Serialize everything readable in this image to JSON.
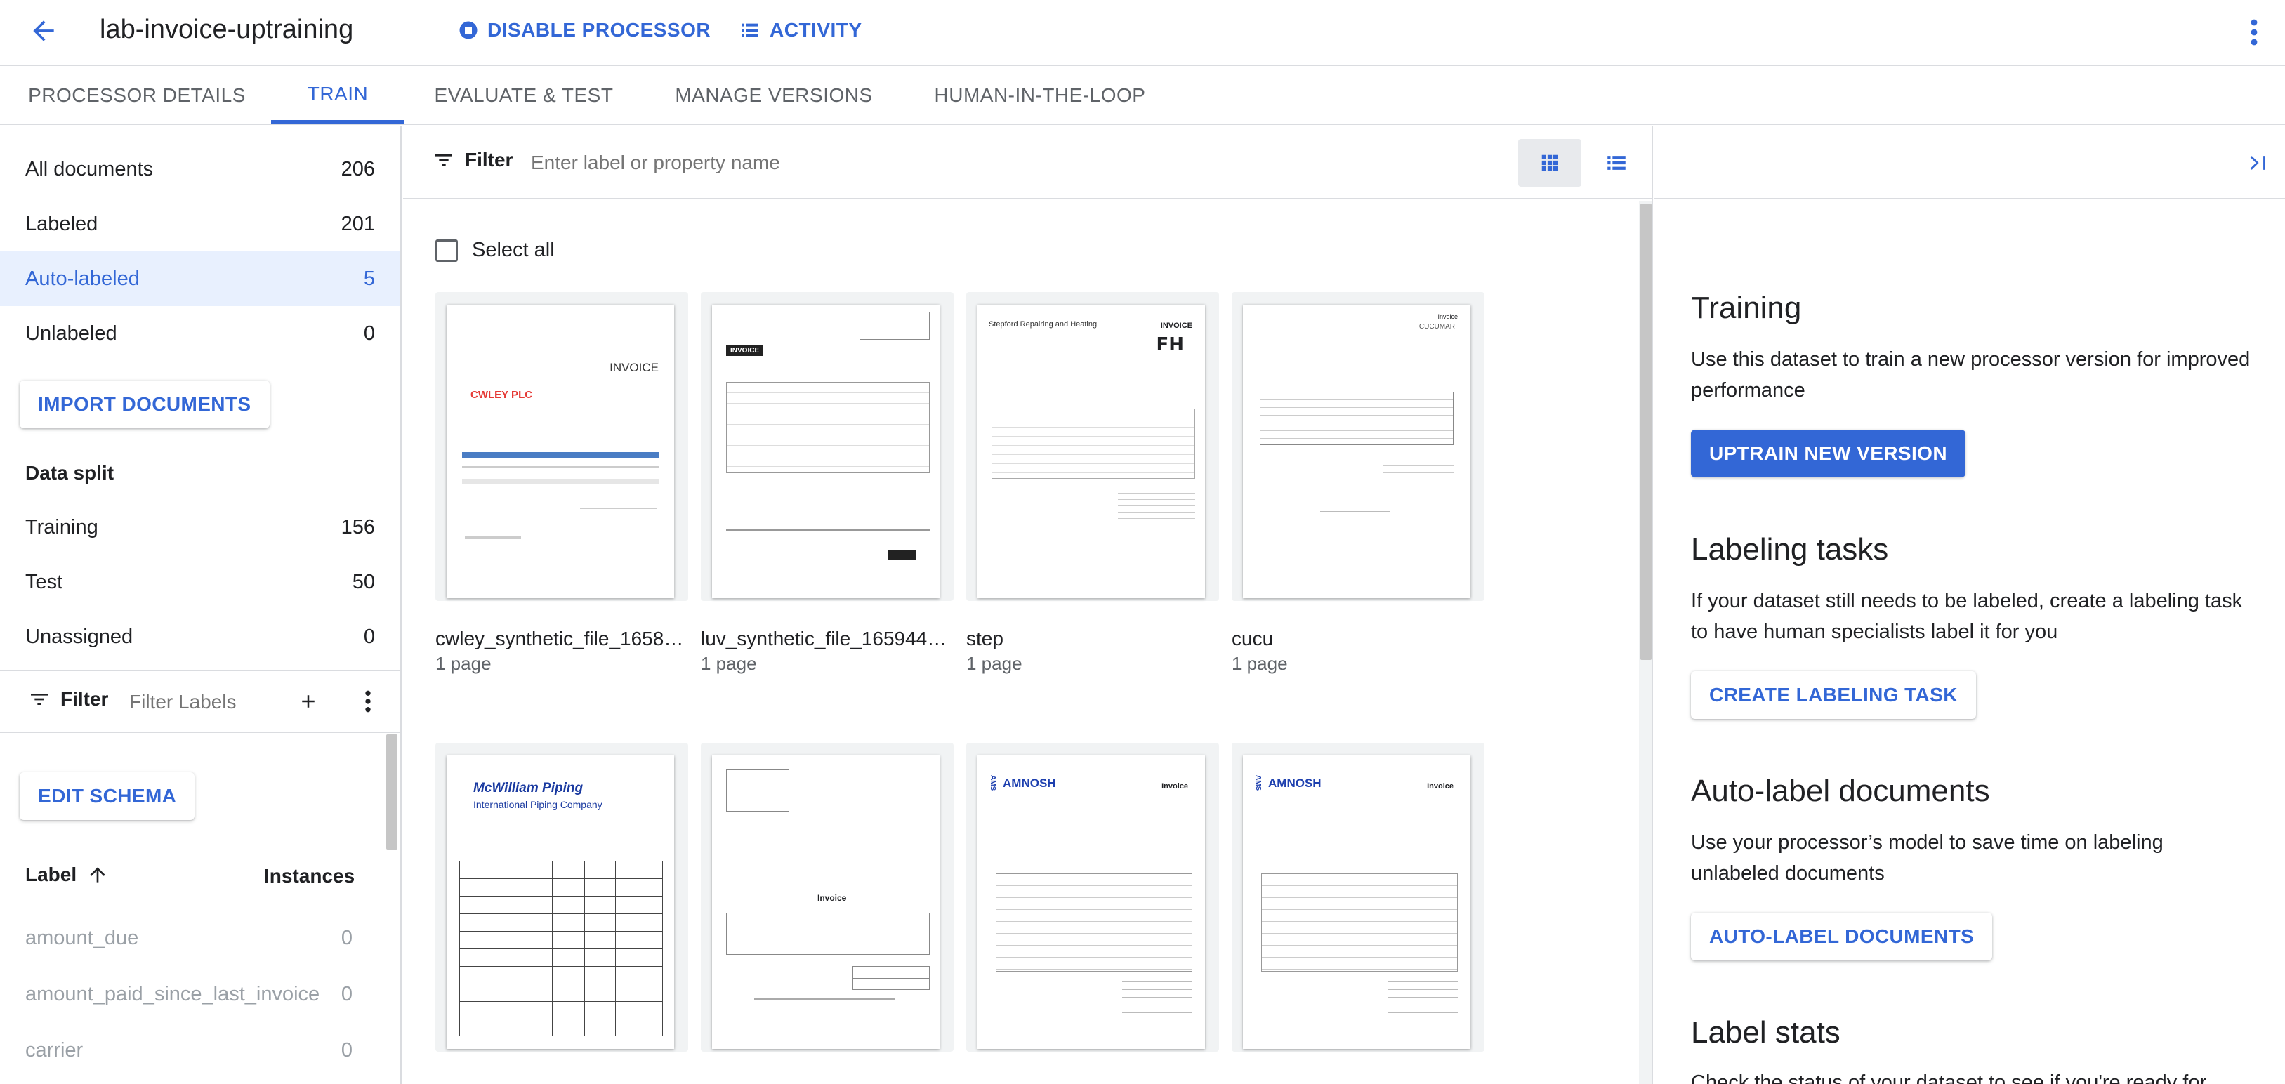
{
  "header": {
    "title": "lab-invoice-uptraining",
    "disable_processor": "DISABLE PROCESSOR",
    "activity": "ACTIVITY"
  },
  "tabs": [
    {
      "label": "PROCESSOR DETAILS",
      "active": false
    },
    {
      "label": "TRAIN",
      "active": true
    },
    {
      "label": "EVALUATE & TEST",
      "active": false
    },
    {
      "label": "MANAGE VERSIONS",
      "active": false
    },
    {
      "label": "HUMAN-IN-THE-LOOP",
      "active": false
    }
  ],
  "sidebar": {
    "doc_filters": [
      {
        "label": "All documents",
        "count": "206"
      },
      {
        "label": "Labeled",
        "count": "201"
      },
      {
        "label": "Auto-labeled",
        "count": "5",
        "selected": true
      },
      {
        "label": "Unlabeled",
        "count": "0"
      }
    ],
    "import_button": "IMPORT DOCUMENTS",
    "data_split_title": "Data split",
    "data_split": [
      {
        "label": "Training",
        "count": "156"
      },
      {
        "label": "Test",
        "count": "50"
      },
      {
        "label": "Unassigned",
        "count": "0"
      }
    ],
    "filter_label": "Filter",
    "filter_placeholder": "Filter Labels",
    "edit_schema": "EDIT SCHEMA",
    "label_header": "Label",
    "instances_header": "Instances",
    "labels": [
      {
        "name": "amount_due",
        "instances": "0"
      },
      {
        "name": "amount_paid_since_last_invoice",
        "instances": "0"
      },
      {
        "name": "carrier",
        "instances": "0"
      }
    ]
  },
  "main": {
    "filter_label": "Filter",
    "filter_placeholder": "Enter label or property name",
    "select_all": "Select all",
    "documents": [
      {
        "name": "cwley_synthetic_file_165893...",
        "pages": "1 page",
        "logo": "CWLEY PLC",
        "heading": "INVOICE"
      },
      {
        "name": "luv_synthetic_file_16594466...",
        "pages": "1 page",
        "logo": "INVOICE",
        "heading": ""
      },
      {
        "name": "step",
        "pages": "1 page",
        "logo": "Stepford Repairing and Heating",
        "heading": "INVOICE"
      },
      {
        "name": "cucu",
        "pages": "1 page",
        "logo": "CUCUMAR",
        "heading": "Invoice"
      },
      {
        "name": "",
        "pages": "",
        "logo": "McWilliam Piping",
        "heading": "International Piping Company"
      },
      {
        "name": "",
        "pages": "",
        "logo": "",
        "heading": "Invoice"
      },
      {
        "name": "",
        "pages": "",
        "logo": "AMNOSH",
        "heading": "Invoice"
      },
      {
        "name": "",
        "pages": "",
        "logo": "AMNOSH",
        "heading": "Invoice"
      }
    ]
  },
  "panel": {
    "training_title": "Training",
    "training_text": "Use this dataset to train a new processor version for improved performance",
    "uptrain_button": "UPTRAIN NEW VERSION",
    "labeling_title": "Labeling tasks",
    "labeling_text": "If your dataset still needs to be labeled, create a labeling task to have human specialists label it for you",
    "labeling_button": "CREATE LABELING TASK",
    "autolabel_title": "Auto-label documents",
    "autolabel_text": "Use your processor’s model to save time on labeling unlabeled documents",
    "autolabel_button": "AUTO-LABEL DOCUMENTS",
    "stats_title": "Label stats",
    "stats_text": "Check the status of your dataset to see if you're ready for"
  },
  "colors": {
    "accent": "#3367d6",
    "selected_bg": "#e8f0fe",
    "border": "#dadce0"
  }
}
